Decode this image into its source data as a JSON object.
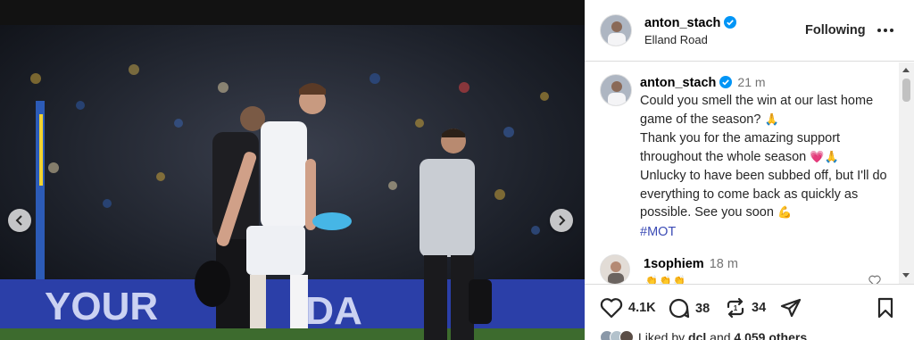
{
  "post": {
    "author": "anton_stach",
    "location": "Elland Road",
    "follow_label": "Following"
  },
  "caption": {
    "username": "anton_stach",
    "time": "21 m",
    "line1": "Could you smell the win at our last home game of the season?",
    "line1_emoji": "🙏",
    "line2": "Thank you for the amazing support throughout the whole season",
    "line2_emoji": "💗🙏",
    "line3": "Unlucky to have been subbed off, but I'll do everything to come back as quickly as possible. See you soon",
    "line3_emoji": "💪",
    "hashtag": "#MOT"
  },
  "comment": {
    "username": "1sophiem",
    "time": "18 m",
    "text": "👏👏👏"
  },
  "actions": {
    "likes": "4.1K",
    "comments": "38",
    "reposts": "34"
  },
  "liked_by": {
    "prefix": "Liked by",
    "user": "dcl",
    "middle": "and",
    "others": "4,059 others"
  },
  "colors": {
    "verified": "#0095f6",
    "hashtag": "#3b4bb5",
    "divider": "#dbdbdb"
  },
  "icons": [
    "verified-badge-icon",
    "more-options-icon",
    "heart-icon",
    "comment-icon",
    "repost-icon",
    "share-icon",
    "bookmark-icon",
    "chevron-left-icon",
    "chevron-right-icon"
  ]
}
